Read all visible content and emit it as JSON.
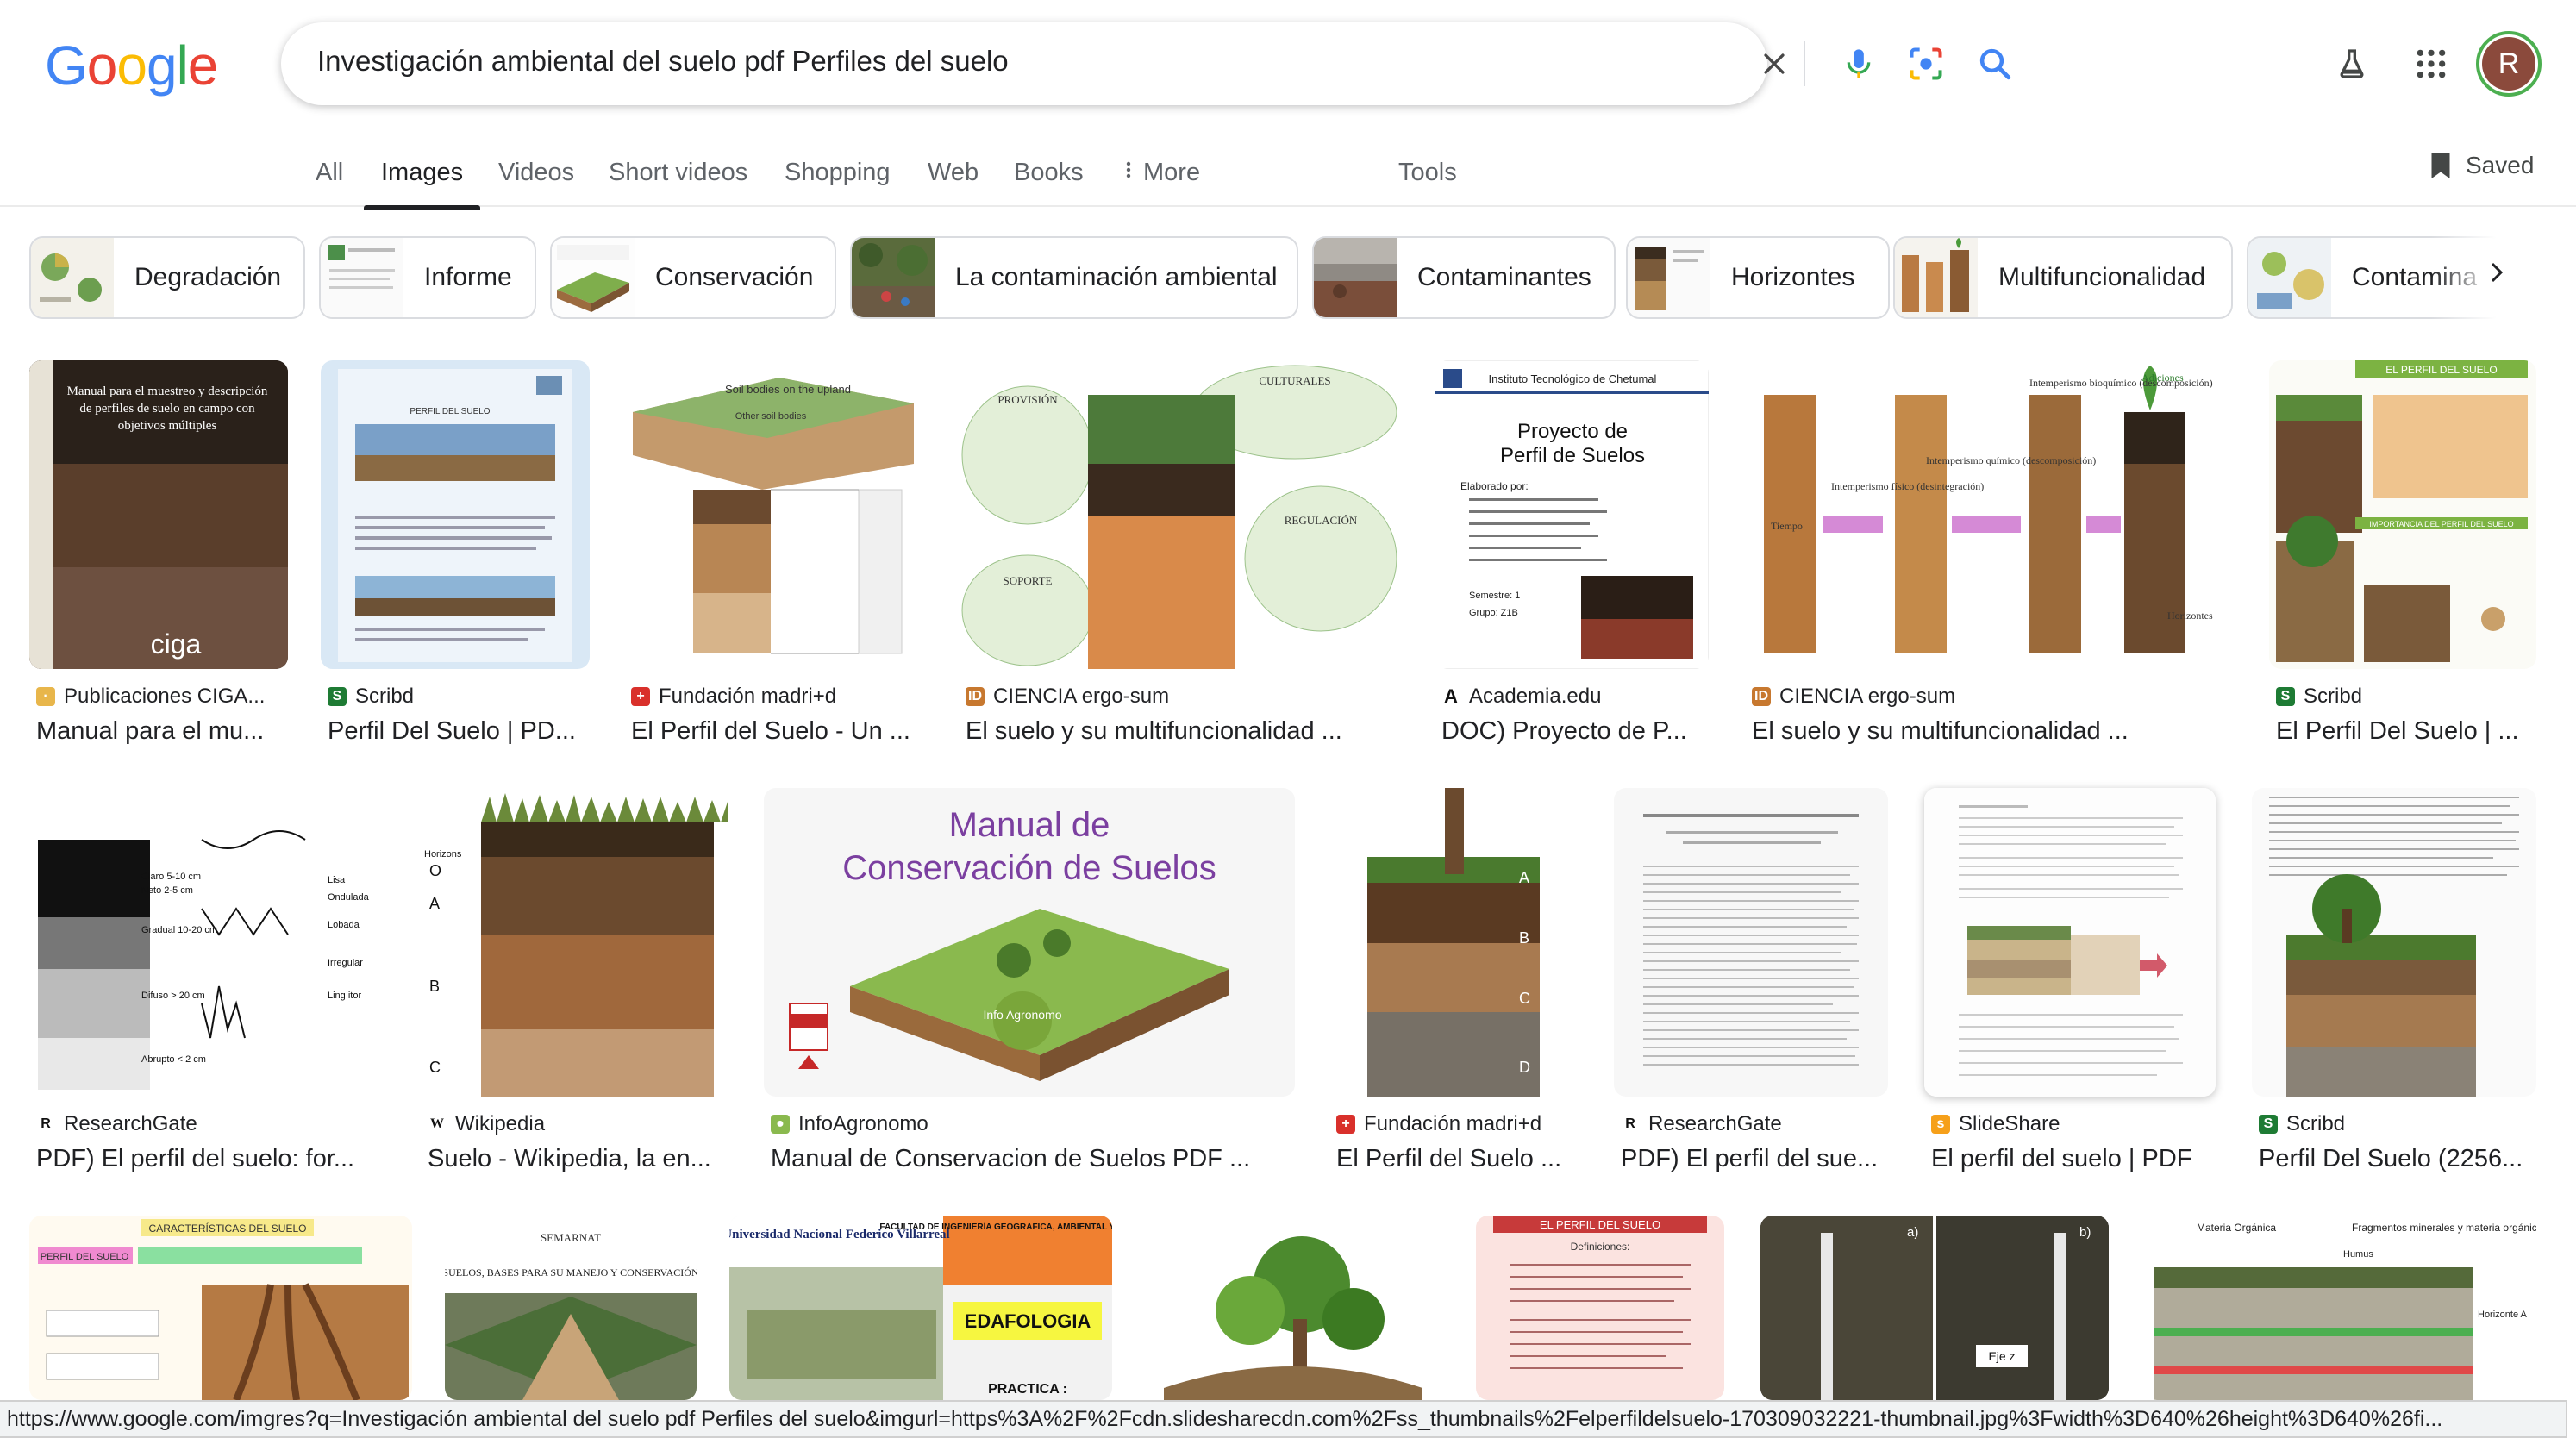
{
  "search": {
    "query": "Investigación ambiental del suelo pdf Perfiles del suelo",
    "logo_letters": [
      {
        "ch": "G",
        "color": "#4285f4"
      },
      {
        "ch": "o",
        "color": "#ea4335"
      },
      {
        "ch": "o",
        "color": "#fbbc05"
      },
      {
        "ch": "g",
        "color": "#4285f4"
      },
      {
        "ch": "l",
        "color": "#34a853"
      },
      {
        "ch": "e",
        "color": "#ea4335"
      }
    ]
  },
  "header": {
    "avatar_letter": "R",
    "icons": [
      "clear-icon",
      "mic-icon",
      "lens-icon",
      "search-icon",
      "labs-flask-icon",
      "apps-grid-icon"
    ]
  },
  "tabs": {
    "items": [
      "All",
      "Images",
      "Videos",
      "Short videos",
      "Shopping",
      "Web",
      "Books",
      "More",
      "Tools"
    ],
    "active": "Images",
    "saved_label": "Saved"
  },
  "chips": [
    "Degradación",
    "Informe",
    "Conservación",
    "La contaminación ambiental",
    "Contaminantes",
    "Horizontes",
    "Multifuncionalidad",
    "Contamina"
  ],
  "results": {
    "row1": [
      {
        "source": "Publicaciones CIGA...",
        "title": "Manual para el mu..."
      },
      {
        "source": "Scribd",
        "title": "Perfil Del Suelo | PD..."
      },
      {
        "source": "Fundación madri+d",
        "title": "El Perfil del Suelo - Un ..."
      },
      {
        "source": "CIENCIA ergo-sum",
        "title": "El suelo y su multifuncionalidad ..."
      },
      {
        "source": "Academia.edu",
        "title": "DOC) Proyecto de P..."
      },
      {
        "source": "CIENCIA ergo-sum",
        "title": "El suelo y su multifuncionalidad ..."
      },
      {
        "source": "Scribd",
        "title": "El Perfil Del Suelo | ..."
      }
    ],
    "row2": [
      {
        "source": "ResearchGate",
        "title": "PDF) El perfil del suelo: for..."
      },
      {
        "source": "Wikipedia",
        "title": "Suelo - Wikipedia, la en..."
      },
      {
        "source": "InfoAgronomo",
        "title": "Manual de Conservacion de Suelos PDF ..."
      },
      {
        "source": "Fundación madri+d",
        "title": "El Perfil del Suelo ..."
      },
      {
        "source": "ResearchGate",
        "title": "PDF) El perfil del sue..."
      },
      {
        "source": "SlideShare",
        "title": "El perfil del suelo | PDF"
      },
      {
        "source": "Scribd",
        "title": "Perfil Del Suelo (2256..."
      }
    ]
  },
  "image_text": {
    "r1_manual": [
      "Manual para el muestreo y descripción",
      "de perfiles de suelo en campo con",
      "objetivos múltiples"
    ],
    "r1_ciga": "ciga",
    "r1_udh_title": "PERFIL DEL SUELO",
    "r1_soil_bodies": [
      "Soil bodies on the upland",
      "Other soil bodies"
    ],
    "r1_ergo_labels": [
      "CULTURALES",
      "PROVISIÓN",
      "REGULACIÓN",
      "SOPORTE"
    ],
    "r1_academia": [
      "Instituto Tecnológico de Chetumal",
      "Proyecto de",
      "Perfil de Suelos",
      "Elaborado por:",
      "Semestre: 1",
      "Grupo: Z1B"
    ],
    "r1_weather": [
      "Intemperismo físico (desintegración)",
      "Intemperismo químico (descomposición)",
      "Intemperismo bioquímico (descomposición)",
      "Tiempo",
      "Adiciones",
      "Horizontes"
    ],
    "r1_scribd_title": "EL PERFIL DEL SUELO",
    "r1_scribd_sub": "IMPORTANCIA DEL PERFIL DEL SUELO",
    "r2_rg_labels": [
      "Claro 5-10 cm",
      "Neto 2-5 cm",
      "Gradual 10-20 cm",
      "Difuso > 20 cm",
      "Abrupto < 2 cm",
      "Lisa",
      "Ondulada",
      "Lobada",
      "Irregular",
      "Ling itor"
    ],
    "r2_wiki_labels": [
      "Horizons",
      "O",
      "A",
      "B",
      "C"
    ],
    "r2_manual_title": [
      "Manual de",
      "Conservación de Suelos"
    ],
    "r2_infoag_badge": "Info Agronomo",
    "r2_fmd_labels": [
      "A",
      "B",
      "C",
      "D"
    ],
    "r3_labels": [
      "CARACTERÍSTICAS DEL SUELO",
      "PERFIL DEL SUELO",
      "SEMARNAT",
      "SUELOS, BASES PARA SU MANEJO Y CONSERVACIÓN",
      "Universidad Nacional Federico Villarreal",
      "FACULTAD DE INGENIERÍA GEOGRÁFICA, AMBIENTAL Y ECOTURISMO",
      "EDAFOLOGIA",
      "PRACTICA :",
      "EL PERFIL DEL SUELO",
      "Definiciones:",
      "a)",
      "b)",
      "Eje z",
      "Materia Orgánica",
      "Fragmentos minerales y materia orgánica",
      "Humus",
      "Horizonte A"
    ]
  },
  "status_url": "https://www.google.com/imgres?q=Investigación ambiental del suelo pdf Perfiles del suelo&imgurl=https%3A%2F%2Fcdn.slidesharecdn.com%2Fss_thumbnails%2Felperfildelsuelo-170309032221-thumbnail.jpg%3Fwidth%3D640%26height%3D640%26fi..."
}
